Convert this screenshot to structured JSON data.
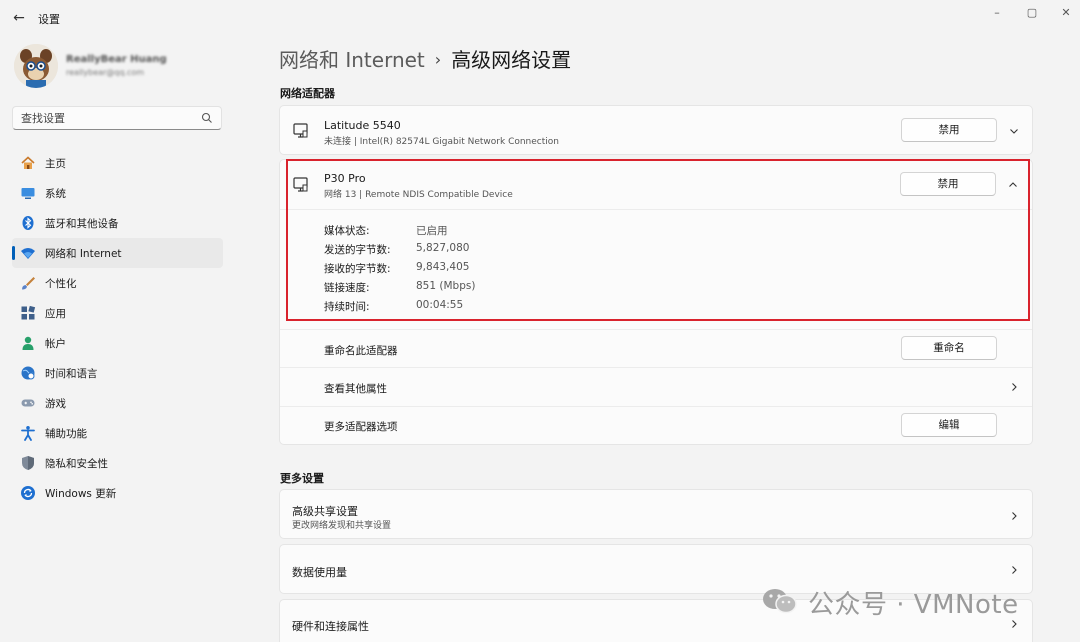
{
  "window": {
    "back_glyph": "←",
    "title": "设置",
    "minimize_glyph": "–",
    "maximize_glyph": "▢",
    "close_glyph": "✕"
  },
  "profile": {
    "name": "ReallyBear Huang",
    "email": "reallybear@qq.com"
  },
  "search": {
    "placeholder": "查找设置"
  },
  "sidebar": {
    "accent_color": "#005fb8",
    "items": [
      {
        "label": "主页",
        "icon": "home-icon"
      },
      {
        "label": "系统",
        "icon": "system-icon"
      },
      {
        "label": "蓝牙和其他设备",
        "icon": "bluetooth-icon"
      },
      {
        "label": "网络和 Internet",
        "icon": "wifi-icon",
        "active": true
      },
      {
        "label": "个性化",
        "icon": "brush-icon"
      },
      {
        "label": "应用",
        "icon": "apps-icon"
      },
      {
        "label": "帐户",
        "icon": "account-icon"
      },
      {
        "label": "时间和语言",
        "icon": "globe-icon"
      },
      {
        "label": "游戏",
        "icon": "gamepad-icon"
      },
      {
        "label": "辅助功能",
        "icon": "accessibility-icon"
      },
      {
        "label": "隐私和安全性",
        "icon": "shield-icon"
      },
      {
        "label": "Windows 更新",
        "icon": "update-icon"
      }
    ]
  },
  "main": {
    "breadcrumb_parent": "网络和 Internet",
    "breadcrumb_sep": "›",
    "breadcrumb_current": "高级网络设置",
    "adapters_section": "网络适配器",
    "adapters": [
      {
        "name": "Latitude 5540",
        "desc": "未连接 | Intel(R) 82574L Gigabit Network Connection",
        "button": "禁用",
        "expanded": false
      },
      {
        "name": "P30 Pro",
        "desc": "网络 13 | Remote NDIS Compatible Device",
        "button": "禁用",
        "expanded": true
      }
    ],
    "properties": [
      {
        "label": "媒体状态:",
        "value": "已启用"
      },
      {
        "label": "发送的字节数:",
        "value": "5,827,080"
      },
      {
        "label": "接收的字节数:",
        "value": "9,843,405"
      },
      {
        "label": "链接速度:",
        "value": "851 (Mbps)"
      },
      {
        "label": "持续时间:",
        "value": "00:04:55"
      }
    ],
    "actions": {
      "rename_label": "重命名此适配器",
      "rename_button": "重命名",
      "view_props_label": "查看其他属性",
      "more_options_label": "更多适配器选项",
      "edit_button": "编辑"
    },
    "more_section": "更多设置",
    "more_settings": [
      {
        "title": "高级共享设置",
        "subtitle": "更改网络发现和共享设置"
      },
      {
        "title": "数据使用量",
        "subtitle": ""
      },
      {
        "title": "硬件和连接属性",
        "subtitle": ""
      }
    ]
  },
  "watermark": {
    "text": "公众号 · VMNote"
  },
  "colors": {
    "highlight_border": "#d9232d",
    "background": "#f3f3f3",
    "card": "#fbfbfb"
  }
}
